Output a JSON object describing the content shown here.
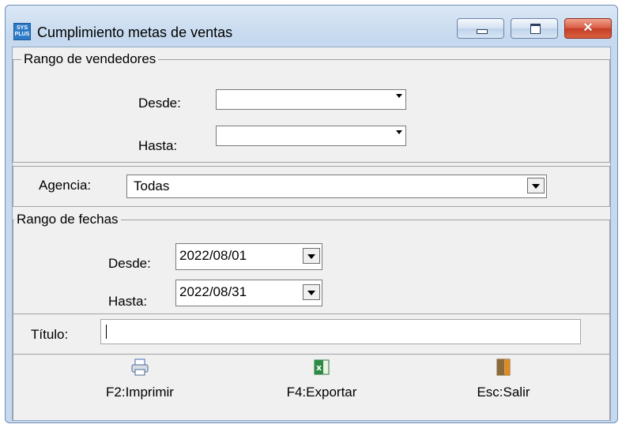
{
  "window": {
    "title": "Cumplimiento metas de ventas",
    "app_icon_text": "SYS PLUS",
    "close_glyph": "✕"
  },
  "vendedores": {
    "legend": "Rango de vendedores",
    "desde_label": "Desde:",
    "desde_value": "",
    "hasta_label": "Hasta:",
    "hasta_value": ""
  },
  "agencia": {
    "label": "Agencia:",
    "value": "Todas"
  },
  "fechas": {
    "legend": "Rango de fechas",
    "desde_label": "Desde:",
    "desde_value": "2022/08/01",
    "hasta_label": "Hasta:",
    "hasta_value": "2022/08/31"
  },
  "titulo": {
    "label": "Título:",
    "value": ""
  },
  "buttons": {
    "print_label": "F2:Imprimir",
    "export_label": "F4:Exportar",
    "exit_label": "Esc:Salir"
  },
  "icons": {
    "print": "printer-icon",
    "export": "excel-icon",
    "exit": "door-icon"
  }
}
